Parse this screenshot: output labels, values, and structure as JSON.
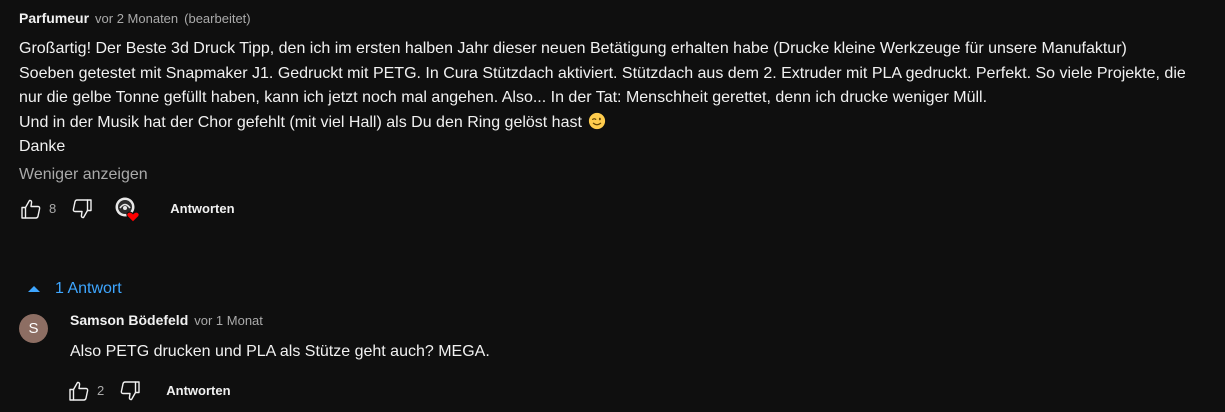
{
  "comment": {
    "author": "Parfumeur",
    "time": "vor 2 Monaten",
    "edited": "(bearbeitet)",
    "lines": [
      "Großartig! Der Beste 3d Druck Tipp, den ich im ersten halben Jahr dieser neuen Betätigung erhalten habe (Drucke kleine Werkzeuge für unsere Manufaktur)",
      "Soeben getestet mit Snapmaker J1. Gedruckt mit PETG. In Cura Stützdach aktiviert. Stützdach aus dem 2. Extruder mit PLA gedruckt. Perfekt. So viele Projekte, die nur die gelbe Tonne gefüllt haben, kann ich jetzt noch mal angehen. Also... In der Tat: Menschheit gerettet, denn ich drucke weniger Müll.",
      "Und in der Musik hat der Chor gefehlt (mit viel Hall) als Du den Ring gelöst hast",
      "Danke"
    ],
    "emoji_icon": "winking-face-emoji",
    "show_less": "Weniger anzeigen",
    "likes": "8",
    "reply_label": "Antworten",
    "heart_icon": "creator-heart-icon"
  },
  "replies_toggle": {
    "label": "1 Antwort",
    "icon": "chevron-up-icon",
    "color": "#3ea6ff"
  },
  "reply": {
    "avatar_letter": "S",
    "avatar_color": "#8d6e63",
    "author": "Samson Bödefeld",
    "time": "vor 1 Monat",
    "text": "Also PETG drucken und PLA als Stütze geht auch? MEGA.",
    "likes": "2",
    "reply_label": "Antworten"
  },
  "colors": {
    "background": "#0f0f0f",
    "text": "#f1f1f1",
    "secondary_text": "#aaaaaa"
  }
}
